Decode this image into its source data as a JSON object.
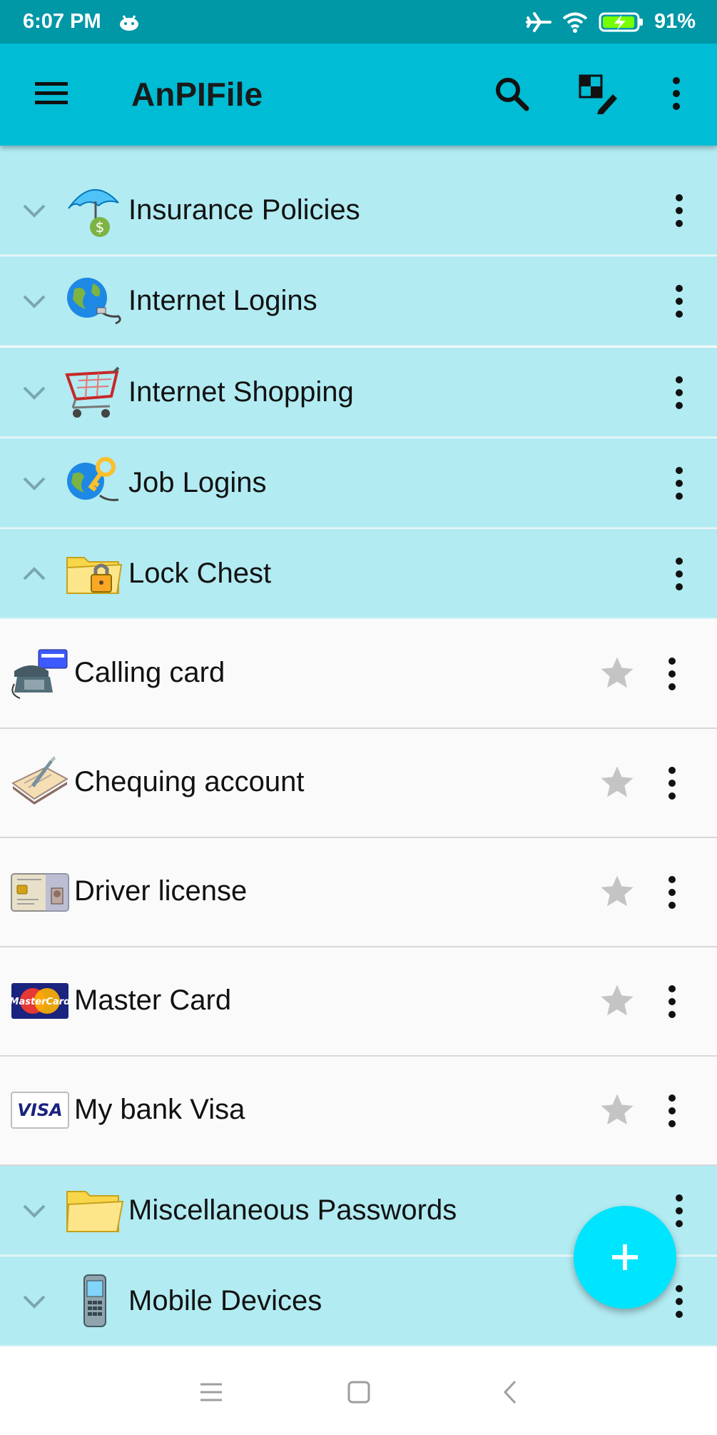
{
  "status": {
    "time": "6:07 PM",
    "battery": "91%"
  },
  "app": {
    "title": "AnPIFile"
  },
  "icons": {
    "menu": "hamburger-menu-icon",
    "search": "search-icon",
    "edit_layout": "grid-edit-icon",
    "more": "more-vertical-icon",
    "star": "star-icon",
    "add": "plus-icon"
  },
  "colors": {
    "statusbar": "#0097A7",
    "appbar": "#00BCD4",
    "category_bg": "#B2EBF2",
    "fab": "#00E5FF",
    "star": "#c4c4c4"
  },
  "categories_top": [
    {
      "label": "Insurance Policies",
      "expanded": false
    },
    {
      "label": "Internet Logins",
      "expanded": false
    },
    {
      "label": "Internet Shopping",
      "expanded": false
    },
    {
      "label": "Job Logins",
      "expanded": false
    },
    {
      "label": "Lock Chest",
      "expanded": true
    }
  ],
  "items": [
    {
      "label": "Calling card",
      "favorite": false
    },
    {
      "label": "Chequing account",
      "favorite": false
    },
    {
      "label": "Driver license",
      "favorite": false
    },
    {
      "label": "Master Card",
      "favorite": false
    },
    {
      "label": "My bank Visa",
      "favorite": false
    }
  ],
  "categories_bottom": [
    {
      "label": "Miscellaneous Passwords",
      "expanded": false
    },
    {
      "label": "Mobile Devices",
      "expanded": false
    }
  ],
  "logos": {
    "mastercard": "MasterCard",
    "visa": "VISA"
  }
}
